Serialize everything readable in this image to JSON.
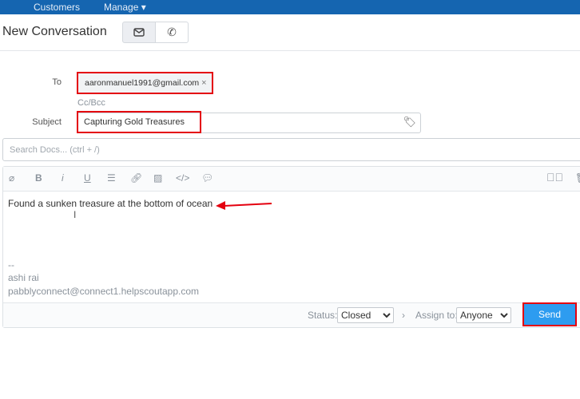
{
  "nav": {
    "items": [
      "Customers",
      "Manage ▾"
    ]
  },
  "header": {
    "title": "New Conversation",
    "modes": [
      {
        "icon": "mail-icon",
        "active": true
      },
      {
        "icon": "phone-icon",
        "active": false
      }
    ]
  },
  "form": {
    "to_label": "To",
    "to_value": "aaronmanuel1991@gmail.com",
    "remove_symbol": "×",
    "ccbcc": "Cc/Bcc",
    "subject_label": "Subject",
    "subject_value": "Capturing Gold Treasures",
    "search_placeholder": "Search Docs... (ctrl + /)"
  },
  "toolbar": [
    "attach-icon",
    "bold-icon",
    "italic-icon",
    "underline-icon",
    "list-icon",
    "link-icon",
    "image-icon",
    "code-icon",
    "saved-reply-icon"
  ],
  "editor": {
    "body": "Found a sunken treasure at the bottom of ocean",
    "sig_sep": "--",
    "sig_name": "ashi rai",
    "sig_email": "pabblyconnect@connect1.helpscoutapp.com"
  },
  "footer": {
    "status_label": "Status:",
    "status_value": "Closed",
    "assign_label": "Assign to:",
    "assign_value": "Anyone",
    "send_label": "Send"
  },
  "colors": {
    "nav": "#1565b0",
    "send": "#2d9cf0",
    "highlight": "#e4000f"
  }
}
